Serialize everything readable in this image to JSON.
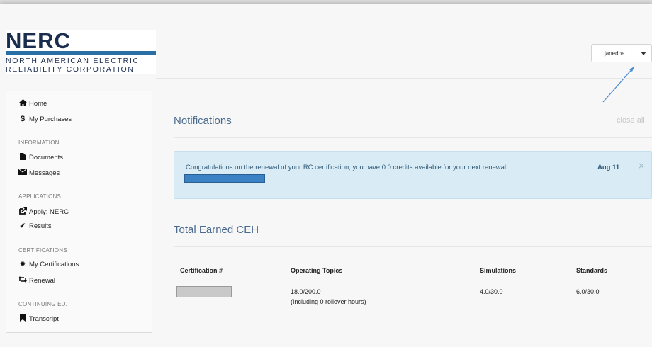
{
  "logo": {
    "word": "NERC",
    "line1": "NORTH AMERICAN ELECTRIC",
    "line2": "RELIABILITY CORPORATION"
  },
  "user_menu": {
    "username": "janedoe",
    "icon": "caret-down-icon"
  },
  "sidebar": {
    "home": {
      "label": "Home",
      "icon": "home-icon"
    },
    "purchases": {
      "label": "My Purchases",
      "icon": "dollar-icon"
    },
    "section_information": "INFORMATION",
    "documents": {
      "label": "Documents",
      "icon": "document-icon"
    },
    "messages": {
      "label": "Messages",
      "icon": "envelope-icon"
    },
    "section_applications": "APPLICATIONS",
    "apply": {
      "label": "Apply: NERC",
      "icon": "external-edit-icon"
    },
    "results": {
      "label": "Results",
      "icon": "check-icon"
    },
    "section_certifications": "CERTIFICATIONS",
    "my_certifications": {
      "label": "My Certifications",
      "icon": "badge-icon"
    },
    "renewal": {
      "label": "Renewal",
      "icon": "retweet-icon"
    },
    "section_continuing": "CONTINUING ED.",
    "transcript": {
      "label": "Transcript",
      "icon": "bookmark-icon"
    }
  },
  "notifications": {
    "title": "Notifications",
    "close_all": "close all",
    "alert": {
      "message": "Congratulations on the renewal of your RC certification, you have 0.0 credits available for your next renewal",
      "date": "Aug 11",
      "close": "×"
    }
  },
  "ceh": {
    "title": "Total Earned CEH",
    "columns": [
      "Certification #",
      "Operating Topics",
      "Simulations",
      "Standards"
    ],
    "row": {
      "operating_topics": "18.0/200.0",
      "operating_note": "(Including 0 rollover hours)",
      "simulations": "4.0/30.0",
      "standards": "6.0/30.0"
    }
  },
  "colors": {
    "accent": "#4a6a8e",
    "alert_bg": "#d9ecf5",
    "alert_text": "#2f5a78",
    "logo_blue": "#2a6ea6"
  }
}
